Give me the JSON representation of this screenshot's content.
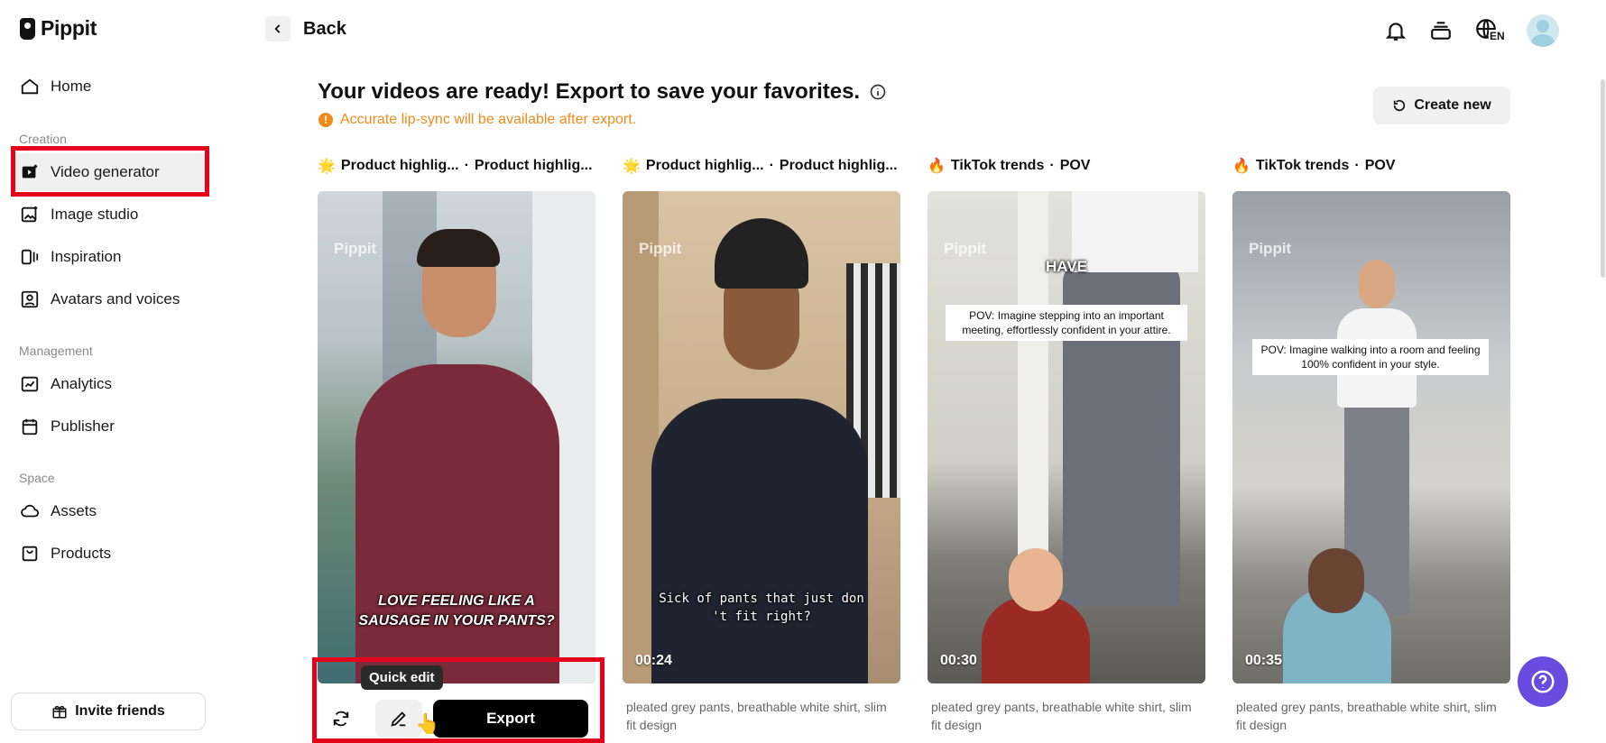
{
  "app": {
    "name": "Pippit"
  },
  "sidebar": {
    "home": "Home",
    "sections": {
      "creation": "Creation",
      "management": "Management",
      "space": "Space"
    },
    "items": {
      "video_generator": "Video generator",
      "image_studio": "Image studio",
      "inspiration": "Inspiration",
      "avatars_voices": "Avatars and voices",
      "analytics": "Analytics",
      "publisher": "Publisher",
      "assets": "Assets",
      "products": "Products"
    },
    "invite": "Invite friends"
  },
  "header": {
    "back": "Back",
    "language": "EN"
  },
  "main": {
    "title": "Your videos are ready! Export to save your favorites.",
    "notice": "Accurate lip-sync will be available after export.",
    "create_new": "Create new"
  },
  "cards": [
    {
      "emoji": "🌟",
      "title": "Product highlig...",
      "title2": "Product highlig...",
      "watermark": "Pippit",
      "caption": "LOVE FEELING LIKE A SAUSAGE IN YOUR PANTS?",
      "actions": {
        "quick_edit_tooltip": "Quick edit",
        "export": "Export"
      }
    },
    {
      "emoji": "🌟",
      "title": "Product highlig...",
      "title2": "Product highlig...",
      "watermark": "Pippit",
      "caption": "Sick of pants that just don 't fit right?",
      "duration": "00:24",
      "description": "pleated grey pants, breathable white shirt, slim fit design"
    },
    {
      "emoji": "🔥",
      "title": "TikTok trends",
      "title2": "POV",
      "watermark": "Pippit",
      "overlay_word": "HAVE",
      "pov_text": "POV: Imagine stepping into an important meeting, effortlessly confident in your attire.",
      "duration": "00:30",
      "description": "pleated grey pants, breathable white shirt, slim fit design"
    },
    {
      "emoji": "🔥",
      "title": "TikTok trends",
      "title2": "POV",
      "watermark": "Pippit",
      "pov_text": "POV: Imagine walking into a room and feeling 100% confident in your style.",
      "duration": "00:35",
      "description": "pleated grey pants, breathable white shirt, slim fit design"
    }
  ],
  "colors": {
    "accent_warning": "#f08a1b",
    "highlight": "#e4001b",
    "help_button": "#6a4be0"
  }
}
